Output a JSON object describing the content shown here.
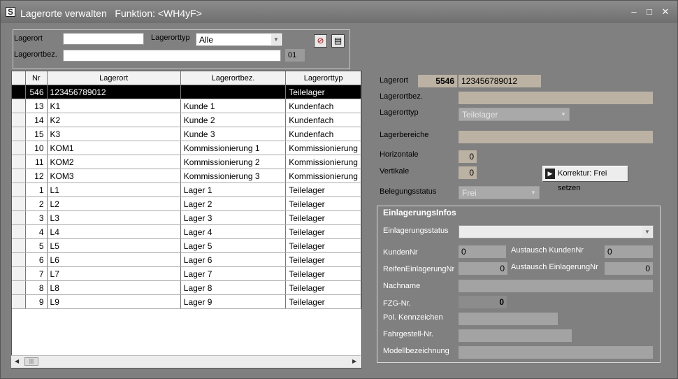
{
  "window": {
    "title": "Lagerorte verwalten   Funktion: <WH4yF>",
    "min": "–",
    "max": "□",
    "close": "✕",
    "icon": "app-logo-icon"
  },
  "filter": {
    "lagerort_label": "Lagerort",
    "lagerort_value": "",
    "lagerorttyp_label": "Lagerorttyp",
    "lagerorttyp_value": "Alle",
    "lagerortbez_label": "Lagerortbez.",
    "lagerortbez_value": "",
    "count": "01",
    "btn_clear_icon": "search-clear-icon",
    "btn_export_icon": "save-icon"
  },
  "grid": {
    "columns": [
      "Nr",
      "Lagerort",
      "Lagerortbez.",
      "Lagerorttyp"
    ],
    "rows": [
      {
        "nr": "546",
        "lagerort": "123456789012",
        "bez": "",
        "typ": "Teilelager"
      },
      {
        "nr": "13",
        "lagerort": "K1",
        "bez": "Kunde 1",
        "typ": "Kundenfach"
      },
      {
        "nr": "14",
        "lagerort": "K2",
        "bez": "Kunde 2",
        "typ": "Kundenfach"
      },
      {
        "nr": "15",
        "lagerort": "K3",
        "bez": "Kunde 3",
        "typ": "Kundenfach"
      },
      {
        "nr": "10",
        "lagerort": "KOM1",
        "bez": "Kommissionierung 1",
        "typ": "Kommissionierung"
      },
      {
        "nr": "11",
        "lagerort": "KOM2",
        "bez": "Kommissionierung 2",
        "typ": "Kommissionierung"
      },
      {
        "nr": "12",
        "lagerort": "KOM3",
        "bez": "Kommissionierung 3",
        "typ": "Kommissionierung"
      },
      {
        "nr": "1",
        "lagerort": "L1",
        "bez": "Lager 1",
        "typ": "Teilelager"
      },
      {
        "nr": "2",
        "lagerort": "L2",
        "bez": "Lager 2",
        "typ": "Teilelager"
      },
      {
        "nr": "3",
        "lagerort": "L3",
        "bez": "Lager 3",
        "typ": "Teilelager"
      },
      {
        "nr": "4",
        "lagerort": "L4",
        "bez": "Lager 4",
        "typ": "Teilelager"
      },
      {
        "nr": "5",
        "lagerort": "L5",
        "bez": "Lager 5",
        "typ": "Teilelager"
      },
      {
        "nr": "6",
        "lagerort": "L6",
        "bez": "Lager 6",
        "typ": "Teilelager"
      },
      {
        "nr": "7",
        "lagerort": "L7",
        "bez": "Lager 7",
        "typ": "Teilelager"
      },
      {
        "nr": "8",
        "lagerort": "L8",
        "bez": "Lager 8",
        "typ": "Teilelager"
      },
      {
        "nr": "9",
        "lagerort": "L9",
        "bez": "Lager 9",
        "typ": "Teilelager"
      }
    ]
  },
  "detail": {
    "lagerort_label": "Lagerort",
    "lagerort_nr": "5546",
    "lagerort_code": "123456789012",
    "lagerortbez_label": "Lagerortbez.",
    "lagerortbez_value": "",
    "lagerorttyp_label": "Lagerorttyp",
    "lagerorttyp_value": "Teilelager",
    "lagerbereiche_label": "Lagerbereiche",
    "lagerbereiche_value": "",
    "horizontale_label": "Horizontale",
    "horizontale_value": "0",
    "vertikale_label": "Vertikale",
    "vertikale_value": "0",
    "korrektur_label": "Korrektur: Frei setzen",
    "belegungsstatus_label": "Belegungsstatus",
    "belegungsstatus_value": "Frei"
  },
  "einlagerung": {
    "title": "EinlagerungsInfos",
    "status_label": "Einlagerungsstatus",
    "status_value": "",
    "kundennr_label": "KundenNr",
    "kundennr_value": "0",
    "austausch_kundennr_label": "Austausch KundenNr",
    "austausch_kundennr_value": "0",
    "reifen_label": "ReifenEinlagerungNr",
    "reifen_value": "0",
    "austausch_einlagerung_label": "Austausch EinlagerungNr",
    "austausch_einlagerung_value": "0",
    "nachname_label": "Nachname",
    "nachname_value": "",
    "fzg_label": "FZG-Nr.",
    "fzg_value": "0",
    "pol_label": "Pol. Kennzeichen",
    "pol_value": "",
    "fahrgestell_label": "Fahrgestell-Nr.",
    "fahrgestell_value": "",
    "modell_label": "Modellbezeichnung",
    "modell_value": ""
  }
}
